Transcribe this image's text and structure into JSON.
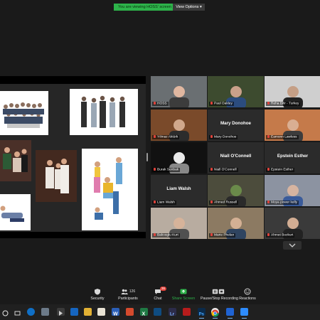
{
  "banner": {
    "message": "You are viewing HOSS' screen",
    "options_label": "View Options ▾"
  },
  "participants": [
    {
      "name": "HOSS",
      "video": true,
      "active": true
    },
    {
      "name": "Paul Oakley",
      "video": true
    },
    {
      "name": "Reha Bilir - Turkey",
      "video": true
    },
    {
      "name": "Yılmaz Aktürk",
      "video": true
    },
    {
      "name": "Mary Donohoe",
      "video": false
    },
    {
      "name": "Eamonn Lawless",
      "video": true
    },
    {
      "name": "Burak Senbak",
      "video": true
    },
    {
      "name": "Niall O'Connell",
      "video": false
    },
    {
      "name": "Epstein Esther",
      "video": false
    },
    {
      "name": "Liam Walsh",
      "video": false
    },
    {
      "name": "Ahmed Russell",
      "video": true
    },
    {
      "name": "Moya power kelly",
      "video": true
    },
    {
      "name": "Balcıoglu Kurt",
      "video": true
    },
    {
      "name": "Marie Phelan",
      "video": true
    },
    {
      "name": "Ahmet Bozkurt",
      "video": true
    }
  ],
  "toolbar": {
    "security": "Security",
    "participants": "Participants",
    "participants_count": "126",
    "chat": "Chat",
    "chat_badge": "36",
    "share": "Share Screen",
    "record": "Pause/Stop Recording",
    "reactions": "Reactions"
  },
  "colors": {
    "banner_green": "#2db34a",
    "active_speaker": "#f3e318",
    "taskbar": "#202020"
  }
}
